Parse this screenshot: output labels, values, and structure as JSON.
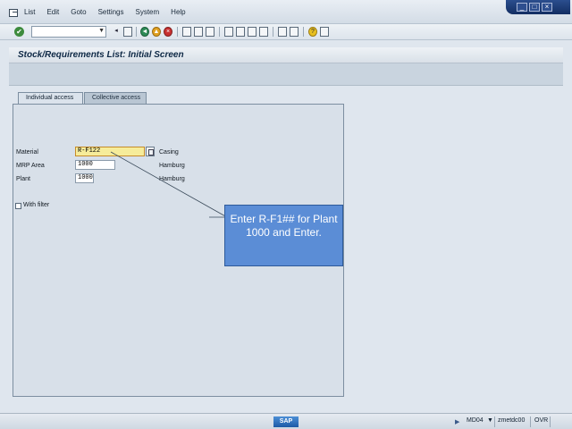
{
  "menu": {
    "items": [
      "List",
      "Edit",
      "Goto",
      "Settings",
      "System",
      "Help"
    ]
  },
  "window_controls": [
    "_",
    "□",
    "×"
  ],
  "toolbar": {
    "command_value": "",
    "icons": [
      "back-icon",
      "save-icon",
      "enter-icon",
      "exit-icon",
      "cancel-icon",
      "print-icon",
      "find-icon",
      "find-next-icon",
      "first-page-icon",
      "prev-page-icon",
      "next-page-icon",
      "last-page-icon",
      "new-session-icon",
      "shortcut-icon",
      "help-icon",
      "layout-icon"
    ]
  },
  "screen": {
    "title": "Stock/Requirements List: Initial Screen"
  },
  "tabs": [
    {
      "label": "Individual access",
      "active": true
    },
    {
      "label": "Collective access",
      "active": false
    }
  ],
  "form": {
    "material": {
      "label": "Material",
      "value": "R-F122",
      "description": "Casing"
    },
    "mrp_area": {
      "label": "MRP Area",
      "value": "1000",
      "description": "Hamburg"
    },
    "plant": {
      "label": "Plant",
      "value": "1000",
      "description": "Hamburg"
    },
    "with_filter": {
      "label": "With filter",
      "checked": false
    }
  },
  "callout": {
    "text": "Enter R-F1## for Plant 1000 and Enter."
  },
  "status": {
    "logo": "SAP",
    "transaction": "MD04",
    "server": "zmetdc00",
    "mode": "OVR"
  },
  "colors": {
    "callout_bg": "#5b8dd6",
    "active_field": "#f6ec9a",
    "title": "#0d2845"
  }
}
